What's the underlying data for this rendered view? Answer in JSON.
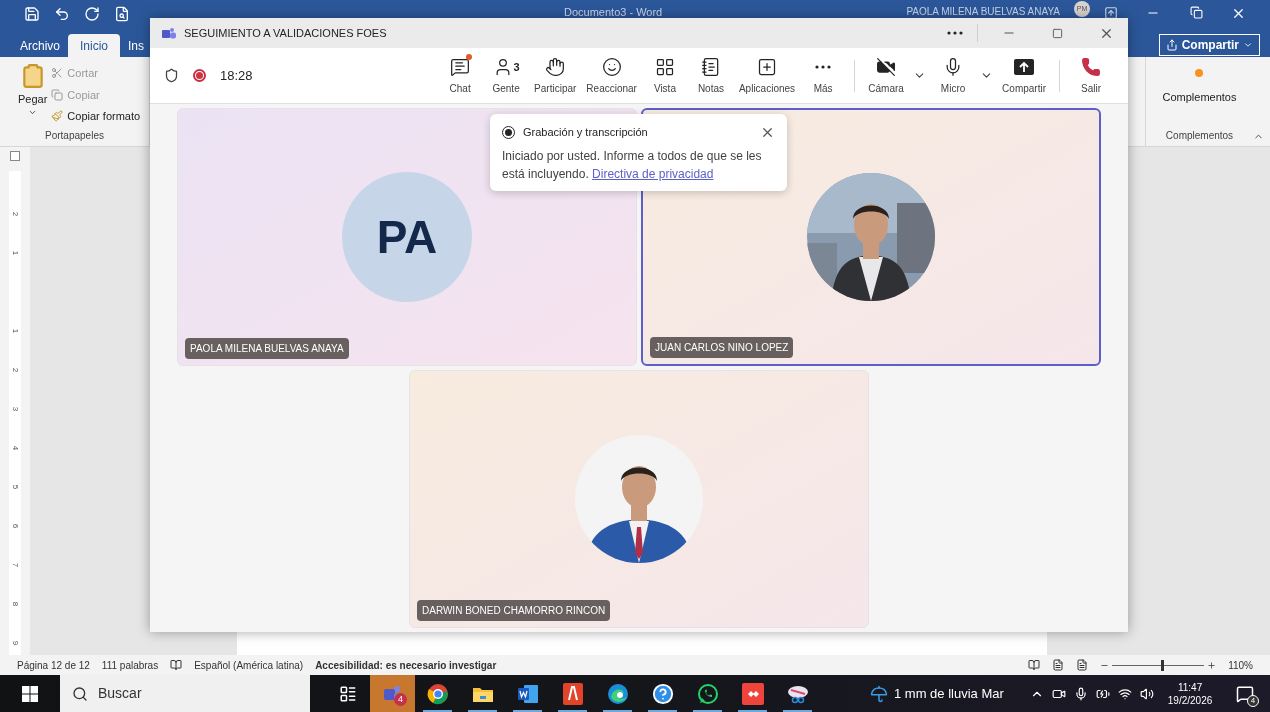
{
  "word": {
    "title": "Documento3 - Word",
    "user": "PAOLA MILENA BUELVAS ANAYA",
    "user_initials": "PM",
    "tabs": [
      {
        "label": "Archivo",
        "selected": false
      },
      {
        "label": "Inicio",
        "selected": true
      },
      {
        "label": "Ins",
        "selected": false
      }
    ],
    "share_button": "Compartir",
    "clipboard": {
      "paste": "Pegar",
      "items": [
        {
          "label": "Cortar",
          "disabled": true
        },
        {
          "label": "Copiar",
          "disabled": true
        },
        {
          "label": "Copiar formato",
          "disabled": false
        }
      ],
      "group": "Portapapeles"
    },
    "addins": {
      "button": "Complementos",
      "group": "Complementos"
    },
    "ruler": [
      "2",
      "1",
      "1",
      "2",
      "3",
      "4",
      "5",
      "6",
      "7",
      "8",
      "9"
    ],
    "status_bar": {
      "page": "Página 12 de 12",
      "words": "111 palabras",
      "language": "Español (América latina)",
      "accessibility": "Accesibilidad: es necesario investigar",
      "zoom": {
        "level": 0.53,
        "reading": "110%"
      }
    }
  },
  "teams": {
    "title": "SEGUIMIENTO A VALIDACIONES FOES",
    "recording": true,
    "timer": "18:28",
    "toolbar": [
      {
        "label": "Chat",
        "notification": true
      },
      {
        "label": "Gente",
        "count": "3"
      },
      {
        "label": "Participar"
      },
      {
        "label": "Reaccionar"
      },
      {
        "label": "Vista"
      },
      {
        "label": "Notas"
      },
      {
        "label": "Aplicaciones"
      },
      {
        "label": "Más"
      },
      {
        "label": "Cámara",
        "dropdown": true
      },
      {
        "label": "Micro",
        "dropdown": true
      },
      {
        "label": "Compartir"
      },
      {
        "label": "Salir"
      }
    ],
    "participants": [
      {
        "name": "PAOLA MILENA BUELVAS ANAYA",
        "kind": "initials",
        "initials": "PA",
        "selected": false
      },
      {
        "name": "JUAN CARLOS NINO LOPEZ",
        "kind": "picture",
        "selected": true
      },
      {
        "name": "DARWIN BONED CHAMORRO RINCON",
        "kind": "picture",
        "selected": false
      }
    ],
    "notice": {
      "title": "Grabación y transcripción",
      "text": "Iniciado por usted. Informe a todos de que se les está incluyendo.",
      "link": "Directiva de privacidad"
    }
  },
  "taskbar": {
    "search": "Buscar",
    "apps": [
      {
        "kind": "taskview",
        "selected": false
      },
      {
        "kind": "teams",
        "badge": "4",
        "selected": true
      },
      {
        "kind": "chrome",
        "selected": false
      },
      {
        "kind": "files",
        "selected": false
      },
      {
        "kind": "word",
        "selected": false
      },
      {
        "kind": "pdf",
        "selected": false
      },
      {
        "kind": "edge",
        "selected": false
      },
      {
        "kind": "help",
        "selected": false
      },
      {
        "kind": "whatsapp",
        "selected": false
      },
      {
        "kind": "remote",
        "selected": false
      },
      {
        "kind": "snip",
        "selected": false
      }
    ],
    "weather": "1 mm de lluvia Mar",
    "time": "11:47",
    "date": "19/2/2026",
    "notifications": "4"
  }
}
